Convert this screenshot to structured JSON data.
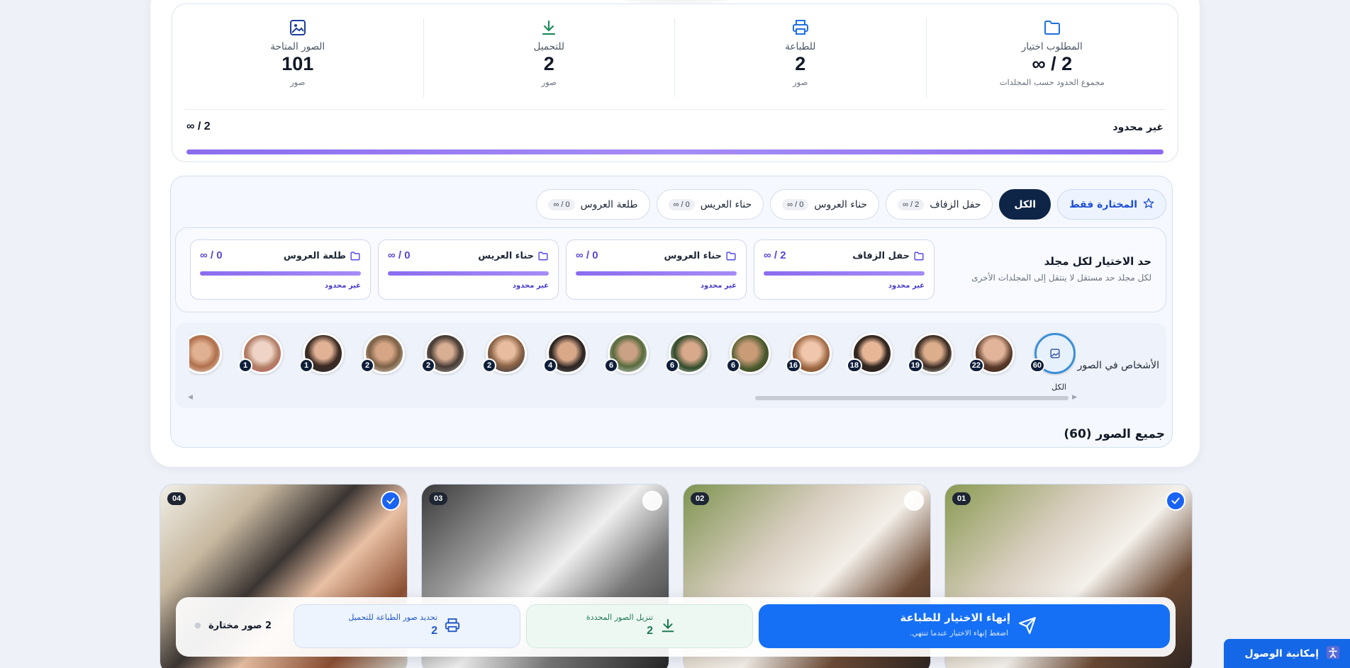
{
  "stats": [
    {
      "label": "المطلوب اختيار",
      "value": "∞ / 2",
      "sub": "مجموع الحدود حسب المجلدات",
      "icon": "folder-icon"
    },
    {
      "label": "للطباعة",
      "value": "2",
      "sub": "صور",
      "icon": "printer-icon"
    },
    {
      "label": "للتحميل",
      "value": "2",
      "sub": "صور",
      "icon": "download-icon"
    },
    {
      "label": "الصور المتاحة",
      "value": "101",
      "sub": "صور",
      "icon": "image-icon"
    }
  ],
  "overall": {
    "label": "غير محدود",
    "value": "∞ / 2",
    "progress_percent": 100
  },
  "tabs": [
    {
      "label": "المختارة فقط",
      "icon": "star-icon"
    },
    {
      "label": "الكل"
    },
    {
      "label": "حفل الزفاف",
      "count": "∞ / 2"
    },
    {
      "label": "حناء العروس",
      "count": "∞ / 0"
    },
    {
      "label": "حناء العريس",
      "count": "∞ / 0"
    },
    {
      "label": "طلعة العروس",
      "count": "∞ / 0"
    }
  ],
  "limits": {
    "title": "حد الاختيار لكل مجلد",
    "subtitle": "لكل مجلد حد مستقل لا ينتقل إلى المجلدات الأخرى",
    "folders": [
      {
        "name": "حفل الزفاف",
        "value": "∞ / 2",
        "status": "غير محدود"
      },
      {
        "name": "حناء العروس",
        "value": "∞ / 0",
        "status": "غير محدود"
      },
      {
        "name": "حناء العريس",
        "value": "∞ / 0",
        "status": "غير محدود"
      },
      {
        "name": "طلعة العروس",
        "value": "∞ / 0",
        "status": "غير محدود"
      }
    ]
  },
  "people": {
    "title": "الأشخاص في الصور",
    "all_label": "الكل",
    "all_count": "60",
    "counts": [
      "22",
      "19",
      "18",
      "16",
      "6",
      "6",
      "6",
      "4",
      "2",
      "2",
      "2",
      "1",
      "1",
      ""
    ]
  },
  "section_title": "جميع الصور (60)",
  "photos": [
    {
      "num": "01",
      "selected": true
    },
    {
      "num": "02",
      "selected": false
    },
    {
      "num": "03",
      "selected": false
    },
    {
      "num": "04",
      "selected": true
    }
  ],
  "actions": {
    "finish_title": "إنهاء الاختيار للطباعة",
    "finish_sub": "اضغط إنهاء الاختيار عندما تنتهي.",
    "download_title": "تنزيل الصور المحددة",
    "download_count": "2",
    "print_title": "تحديد صور الطباعة للتحميل",
    "print_count": "2",
    "selected_count": "2 صور مختارة"
  },
  "accessibility_label": "إمكانية الوصول",
  "colors": {
    "accent": "#1570f5",
    "dark_tab": "#0e2547",
    "progress": "#8b6cf0",
    "download": "#1e7a54"
  }
}
